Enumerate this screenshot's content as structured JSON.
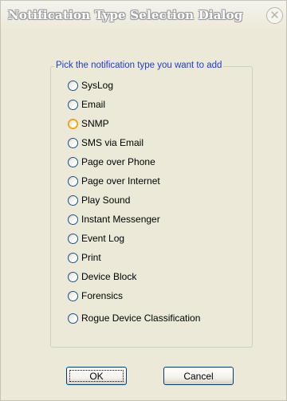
{
  "dialog": {
    "title": "Notification Type Selection Dialog",
    "close_symbol": "✕"
  },
  "group": {
    "legend": "Pick the notification type you want to add",
    "options": [
      {
        "label": "SysLog"
      },
      {
        "label": "Email"
      },
      {
        "label": "SNMP"
      },
      {
        "label": "SMS via Email"
      },
      {
        "label": "Page over Phone"
      },
      {
        "label": "Page over Internet"
      },
      {
        "label": "Play Sound"
      },
      {
        "label": "Instant Messenger"
      },
      {
        "label": "Event Log"
      },
      {
        "label": "Print"
      },
      {
        "label": "Device Block"
      },
      {
        "label": "Forensics"
      },
      {
        "label": "Rogue Device Classification"
      }
    ],
    "hovered_option": "SNMP"
  },
  "buttons": {
    "ok_label": "OK",
    "cancel_label": "Cancel"
  },
  "colors": {
    "dialog_bg": "#ece9d8",
    "legend_text": "#1e3dc8",
    "radio_border": "#1c5180",
    "radio_hover": "#e59700",
    "button_border": "#003c74"
  },
  "icons": {
    "close": "close-icon",
    "radio": "radio-circle-icon"
  }
}
